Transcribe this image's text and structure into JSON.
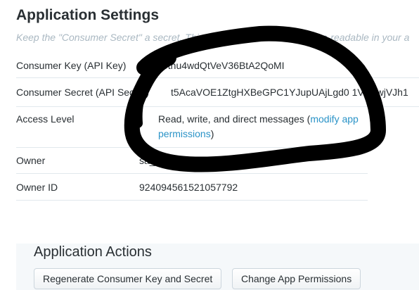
{
  "page": {
    "title": "Application Settings",
    "note": "Keep the \"Consumer Secret\" a secret. This key should never be human-readable in your a"
  },
  "settings": {
    "consumer_key": {
      "label": "Consumer Key (API Key)",
      "value": "0tnu4wdQtVeV36BtA2QoMI"
    },
    "consumer_secret": {
      "label": "Consumer Secret (API Secret)",
      "value": "t5AcaVOE1ZtgHXBeGPC1YJupUAjLgd0 1VC4wjVJh1"
    },
    "access_level": {
      "label": "Access Level",
      "value": "Read, write, and direct messages (",
      "link_line1": "modify app",
      "link_line2": "permissions",
      "suffix": ")"
    },
    "owner": {
      "label": "Owner",
      "value": "sa_"
    },
    "owner_id": {
      "label": "Owner ID",
      "value": "924094561521057792"
    }
  },
  "actions": {
    "title": "Application Actions",
    "regenerate_label": "Regenerate Consumer Key and Secret",
    "change_permissions_label": "Change App Permissions"
  },
  "colors": {
    "link": "#2a93c7",
    "heading": "#292f33",
    "note": "#aab8c2",
    "redaction": "#000000"
  }
}
